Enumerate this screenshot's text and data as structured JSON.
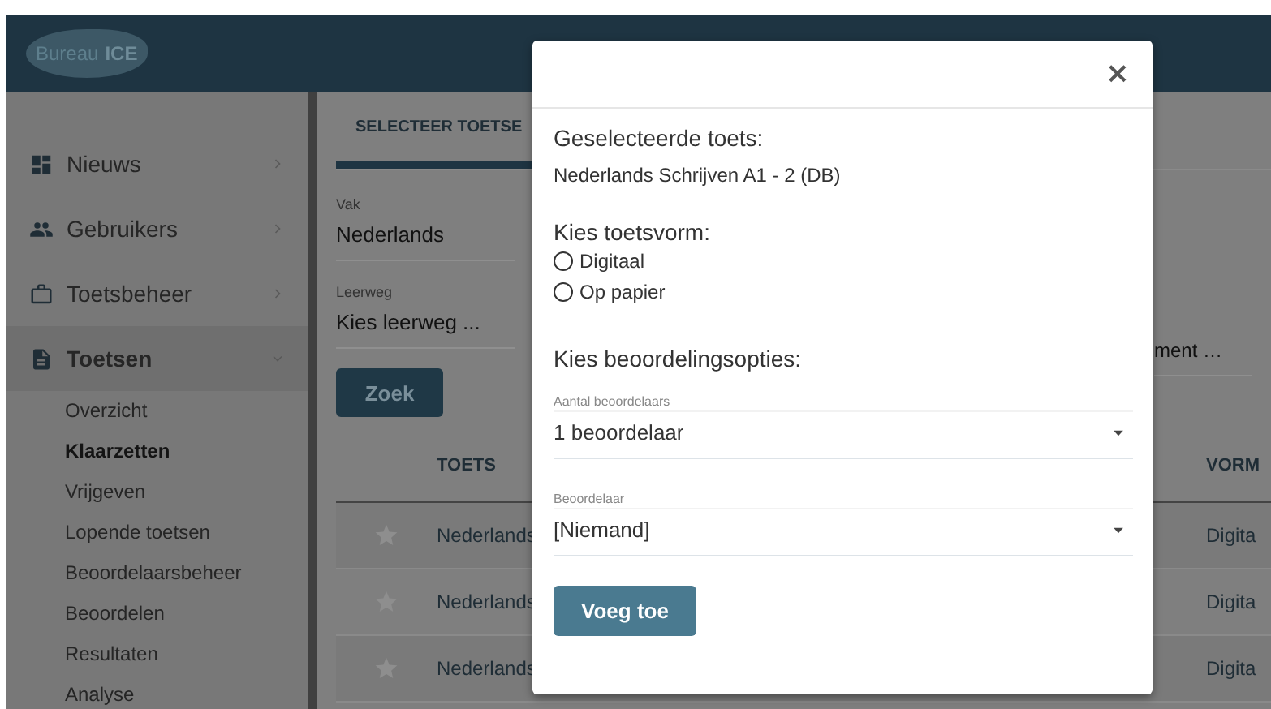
{
  "header": {
    "logo": {
      "word": "Bureau",
      "name": "ICE"
    }
  },
  "sidebar": {
    "items": [
      {
        "label": "Nieuws",
        "expanded": false
      },
      {
        "label": "Gebruikers",
        "expanded": false
      },
      {
        "label": "Toetsbeheer",
        "expanded": false
      },
      {
        "label": "Toetsen",
        "expanded": true,
        "children": [
          {
            "label": "Overzicht",
            "selected": false
          },
          {
            "label": "Klaarzetten",
            "selected": true
          },
          {
            "label": "Vrijgeven",
            "selected": false
          },
          {
            "label": "Lopende toetsen",
            "selected": false
          },
          {
            "label": "Beoordelaarsbeheer",
            "selected": false
          },
          {
            "label": "Beoordelen",
            "selected": false
          },
          {
            "label": "Resultaten",
            "selected": false
          },
          {
            "label": "Analyse",
            "selected": false
          }
        ]
      }
    ]
  },
  "content": {
    "tab": {
      "label": "SELECTEER TOETSE",
      "selected": true
    },
    "fields": [
      {
        "label": "Vak",
        "value": "Nederlands"
      },
      {
        "label": "Leerweg",
        "value": "Kies leerweg ..."
      }
    ],
    "field_fragment": "ment …",
    "search_button": "Zoek",
    "table": {
      "columns": [
        "TOETS",
        "VORM"
      ],
      "rows": [
        {
          "starred": false,
          "toets": "Nederlands",
          "vorm": "Digita"
        },
        {
          "starred": false,
          "toets": "Nederlands",
          "vorm": "Digita"
        },
        {
          "starred": false,
          "toets": "Nederlands",
          "vorm": "Digita"
        }
      ]
    }
  },
  "modal": {
    "close": "×",
    "selected_heading": "Geselecteerde toets:",
    "selected_test": "Nederlands Schrijven A1 - 2 (DB)",
    "form_heading": "Kies toetsvorm:",
    "form_options": [
      {
        "label": "Digitaal",
        "selected": false
      },
      {
        "label": "Op papier",
        "selected": false
      }
    ],
    "options_heading": "Kies beoordelingsopties:",
    "selects": [
      {
        "label": "Aantal beoordelaars",
        "value": "1 beoordelaar"
      },
      {
        "label": "Beoordelaar",
        "value": "[Niemand]"
      }
    ],
    "submit": "Voeg toe"
  }
}
